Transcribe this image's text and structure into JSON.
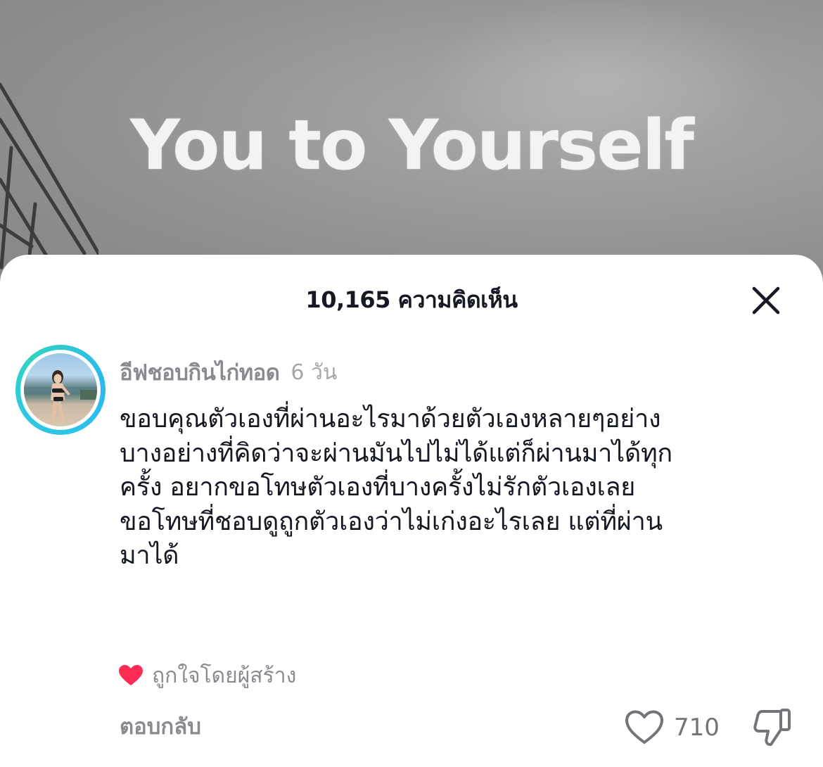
{
  "video": {
    "overlay_text": "You to Yourself"
  },
  "comments_sheet": {
    "count_label": "10,165 ความคิดเห็น",
    "close_icon": "close-icon"
  },
  "comment": {
    "username": "อีฟชอบกินไก่ทอด",
    "timestamp": "6 วัน",
    "text_lines": [
      "ขอบคุณตัวเองที่ผ่านอะไรมาด้วยตัวเองหลายๆอย่าง",
      "บางอย่างที่คิดว่าจะผ่านมันไปไม่ได้แต่ก็ผ่านมาได้ทุก",
      "ครั้ง อยากขอโทษตัวเองที่บางครั้งไม่รักตัวเองเลย",
      "ขอโทษที่ชอบดูถูกตัวเองว่าไม่เก่งอะไรเลย แต่ที่ผ่าน",
      "มาได้"
    ],
    "liked_by_creator": "ถูกใจโดยผู้สร้าง",
    "reply_label": "ตอบกลับ",
    "like_count": "710",
    "avatar_ring_color": "#2ec6e6",
    "heart_color": "#fe2c55"
  }
}
